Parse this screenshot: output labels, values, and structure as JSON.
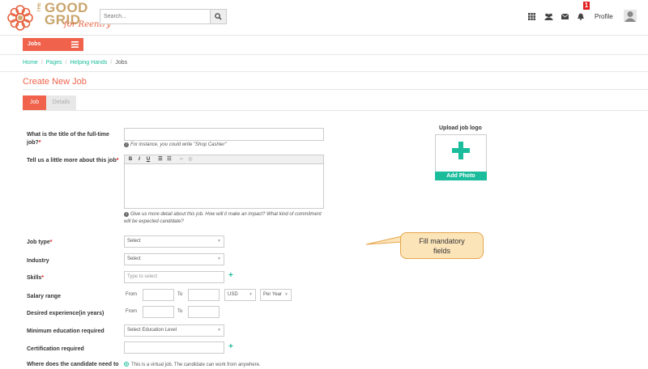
{
  "brand": {
    "line1": "GOOD",
    "line2": "GRID",
    "prefix": "THE",
    "sub": "for Reentry",
    "accent": "#f0624b",
    "teal": "#1abc9c"
  },
  "search": {
    "placeholder": "Search..."
  },
  "header": {
    "notification_count": "1",
    "profile_label": "Profile",
    "icons": [
      "grid-icon",
      "users-icon",
      "envelope-icon",
      "bell-icon",
      "avatar-icon"
    ]
  },
  "nav": {
    "jobs_label": "Jobs"
  },
  "breadcrumb": {
    "items": [
      "Home",
      "Pages",
      "Helping Hands",
      "Jobs"
    ]
  },
  "page": {
    "title": "Create New Job"
  },
  "tabs": {
    "job": "Job",
    "details": "Details"
  },
  "form": {
    "title_label": "What is the title of the full-time job?",
    "title_hint": "For instance, you could write \"Shop Cashier\"",
    "description_label": "Tell us a little more about this job",
    "description_hint": "Give us more detail about this job. How will it make an impact? What kind of commitment will be expected candidate?",
    "job_type_label": "Job type",
    "job_type_value": "Select",
    "industry_label": "Industry",
    "industry_value": "Select",
    "skills_label": "Skills",
    "skills_placeholder": "Type to select",
    "salary_label": "Salary range",
    "salary_from": "From",
    "salary_to": "To",
    "currency": "USD",
    "period": "Per Year",
    "experience_label": "Desired experience(in years)",
    "exp_from": "From",
    "exp_to": "To",
    "education_label": "Minimum education required",
    "education_value": "Select Education Level",
    "certification_label": "Certification required",
    "location_label": "Where does the candidate need to",
    "virtual_option": "This is a virtual job. The candidate can work from anywhere."
  },
  "upload": {
    "label": "Upload job logo",
    "button": "Add Photo"
  },
  "callout": {
    "line1": "Fill mandatory",
    "line2": "fields"
  }
}
